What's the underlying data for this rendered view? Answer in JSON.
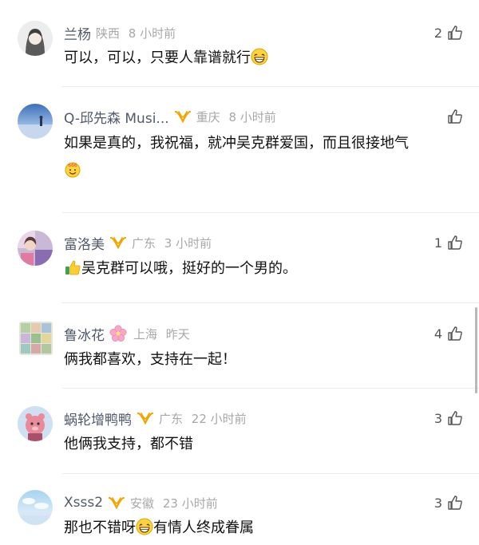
{
  "comments": [
    {
      "username": "兰杨",
      "location": "陕西",
      "time": "8 小时前",
      "likes": "2",
      "text": "可以，可以，只要人靠谱就行",
      "text_after": ""
    },
    {
      "username": "Q-邱先森 Musi...",
      "location": "重庆",
      "time": "8 小时前",
      "likes": "",
      "text": "如果是真的，我祝福，就冲吴克群爱国，而且很接地气",
      "text_after": ""
    },
    {
      "username": "富洛美",
      "location": "广东",
      "time": "3 小时前",
      "likes": "1",
      "text": "吴克群可以哦，挺好的一个男的。",
      "text_after": ""
    },
    {
      "username": "鲁冰花",
      "location": "上海",
      "time": "昨天",
      "likes": "4",
      "text": "俩我都喜欢，支持在一起！",
      "text_after": ""
    },
    {
      "username": "蜗轮增鸭鸭",
      "location": "广东",
      "time": "22 小时前",
      "likes": "3",
      "text": "他俩我支持，都不错",
      "text_after": ""
    },
    {
      "username": "Xsss2",
      "location": "安徽",
      "time": "23 小时前",
      "likes": "3",
      "text": "那也不错呀",
      "text_after": "有情人终成眷属"
    }
  ],
  "icons": {
    "vip": "vip-badge-icon",
    "like": "thumbs-up-icon",
    "grin": "grinning-emoji-icon",
    "thumbs": "thumbs-up-emoji-icon",
    "flower": "cherry-blossom-icon"
  },
  "colors": {
    "username": "#505a6b",
    "meta": "#a8a8a8",
    "vip": "#f0a500",
    "divider": "#ececec"
  }
}
